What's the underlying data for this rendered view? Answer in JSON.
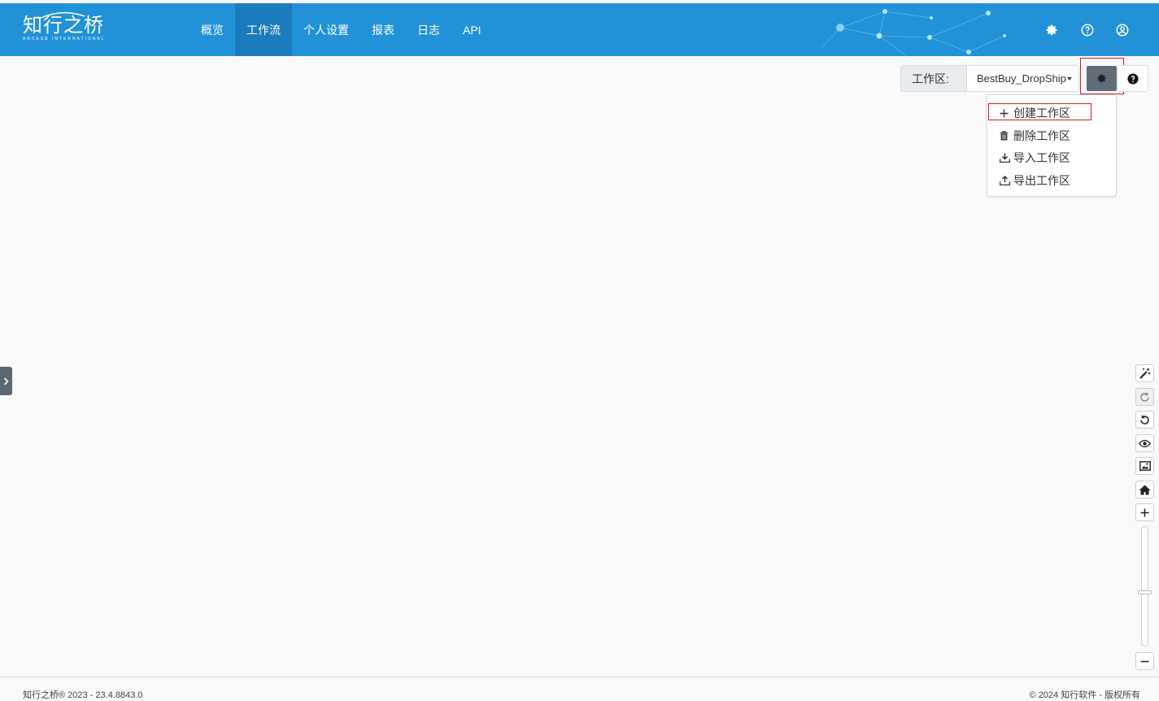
{
  "header": {
    "logo_text": "知行之桥",
    "logo_subtext": "ARCESB INTERNATIONAL",
    "nav": [
      {
        "label": "概览",
        "active": false
      },
      {
        "label": "工作流",
        "active": true
      },
      {
        "label": "个人设置",
        "active": false
      },
      {
        "label": "报表",
        "active": false
      },
      {
        "label": "日志",
        "active": false
      },
      {
        "label": "API",
        "active": false
      }
    ],
    "icons": [
      "gear-icon",
      "help-circle-icon",
      "user-circle-icon"
    ]
  },
  "workspace": {
    "label": "工作区:",
    "selected": "BestBuy_DropShip",
    "settings_icon": "gear-icon",
    "help_icon": "question-circle-icon"
  },
  "workspace_menu": {
    "items": [
      {
        "label": "创建工作区",
        "icon": "plus-icon",
        "highlighted": true
      },
      {
        "label": "删除工作区",
        "icon": "trash-icon",
        "highlighted": false
      },
      {
        "label": "导入工作区",
        "icon": "download-icon",
        "highlighted": false
      },
      {
        "label": "导出工作区",
        "icon": "upload-icon",
        "highlighted": false
      }
    ]
  },
  "canvas_tools": [
    {
      "name": "magic-wand-icon",
      "enabled": true
    },
    {
      "name": "redo-icon",
      "enabled": false
    },
    {
      "name": "undo-icon",
      "enabled": true
    },
    {
      "name": "eye-icon",
      "enabled": true
    },
    {
      "name": "image-icon",
      "enabled": true
    },
    {
      "name": "home-icon",
      "enabled": true
    },
    {
      "name": "zoom-in-icon",
      "enabled": true
    },
    {
      "name": "zoom-out-icon",
      "enabled": true
    }
  ],
  "zoom": {
    "level_fraction": 0.45
  },
  "footer": {
    "left": "知行之桥® 2023 - 23.4.8843.0",
    "right": "© 2024 知行软件 - 版权所有"
  },
  "colors": {
    "header": "#2192d8",
    "header_active": "#1b7bbd",
    "gear_button": "#616c76",
    "highlight": "#d8172a"
  }
}
